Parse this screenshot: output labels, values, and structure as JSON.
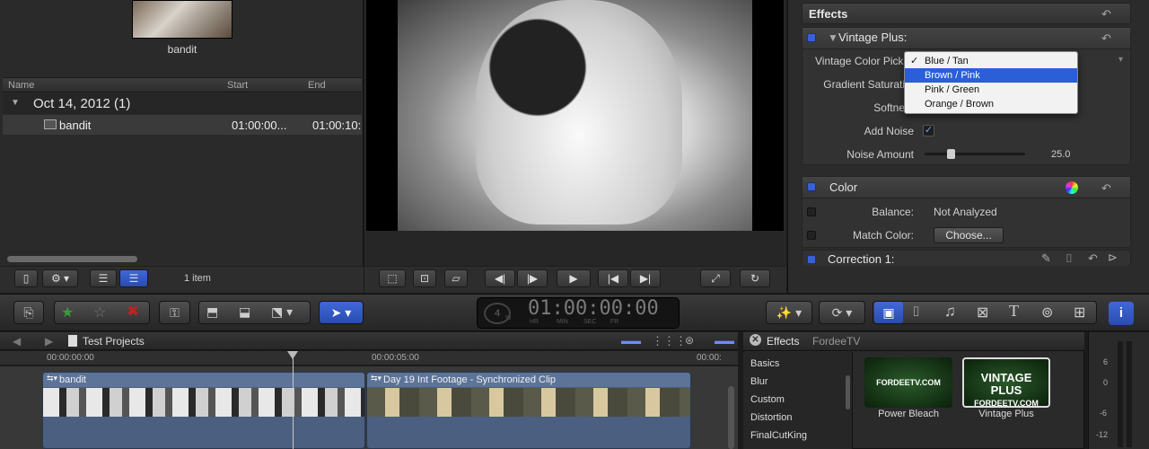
{
  "browser": {
    "thumb_label": "bandit",
    "columns": {
      "name": "Name",
      "start": "Start",
      "end": "End"
    },
    "group": {
      "label": "Oct 14, 2012  (1)"
    },
    "clip": {
      "name": "bandit",
      "start": "01:00:00...",
      "end": "01:00:10:"
    },
    "item_count": "1 item"
  },
  "inspector": {
    "effects_title": "Effects",
    "vintage": {
      "title": "Vintage Plus:",
      "color_picker_label": "Vintage Color Pick",
      "gradient_label": "Gradient Saturati",
      "softness_label": "Softne",
      "add_noise_label": "Add Noise",
      "noise_amount_label": "Noise Amount",
      "noise_amount_value": "25.0",
      "noise_fraction": 0.25,
      "popup": {
        "options": [
          "Blue / Tan",
          "Brown / Pink",
          "Pink / Green",
          "Orange / Brown"
        ],
        "checked": "Blue / Tan",
        "highlighted": "Brown / Pink"
      }
    },
    "color": {
      "title": "Color",
      "balance_label": "Balance:",
      "balance_value": "Not Analyzed",
      "match_label": "Match Color:",
      "choose_button": "Choose..."
    },
    "correction": {
      "title": "Correction 1:"
    }
  },
  "toolbar": {
    "timecode": "01:00:00:00",
    "tc_units": [
      "HR",
      "MIN",
      "SEC",
      "FR"
    ],
    "tc_percent": "%",
    "tc_ring_value": "4"
  },
  "timeline": {
    "project": "Test Projects",
    "ruler": [
      "00:00:00:00",
      "00:00:05:00",
      "00:00:"
    ],
    "clips": [
      {
        "name": "bandit"
      },
      {
        "name": "Day 19 Int Footage - Synchronized Clip"
      }
    ]
  },
  "effects_browser": {
    "title": "Effects",
    "source": "FordeeTV",
    "categories": [
      "Basics",
      "Blur",
      "Custom",
      "Distortion",
      "FinalCutKing"
    ],
    "items": [
      {
        "label": "Power Bleach",
        "thumb_text": "FORDEETV.COM"
      },
      {
        "label": "Vintage Plus",
        "thumb_text": "VINTAGE PLUS",
        "thumb_sub": "FORDEETV.COM"
      }
    ]
  },
  "meters": {
    "ticks": [
      "6",
      "0",
      "-6",
      "-12"
    ]
  },
  "colors": {
    "accent_blue": "#3b5fd6",
    "selection": "#2a5fd8",
    "clip_blue": "#4b5f80"
  }
}
